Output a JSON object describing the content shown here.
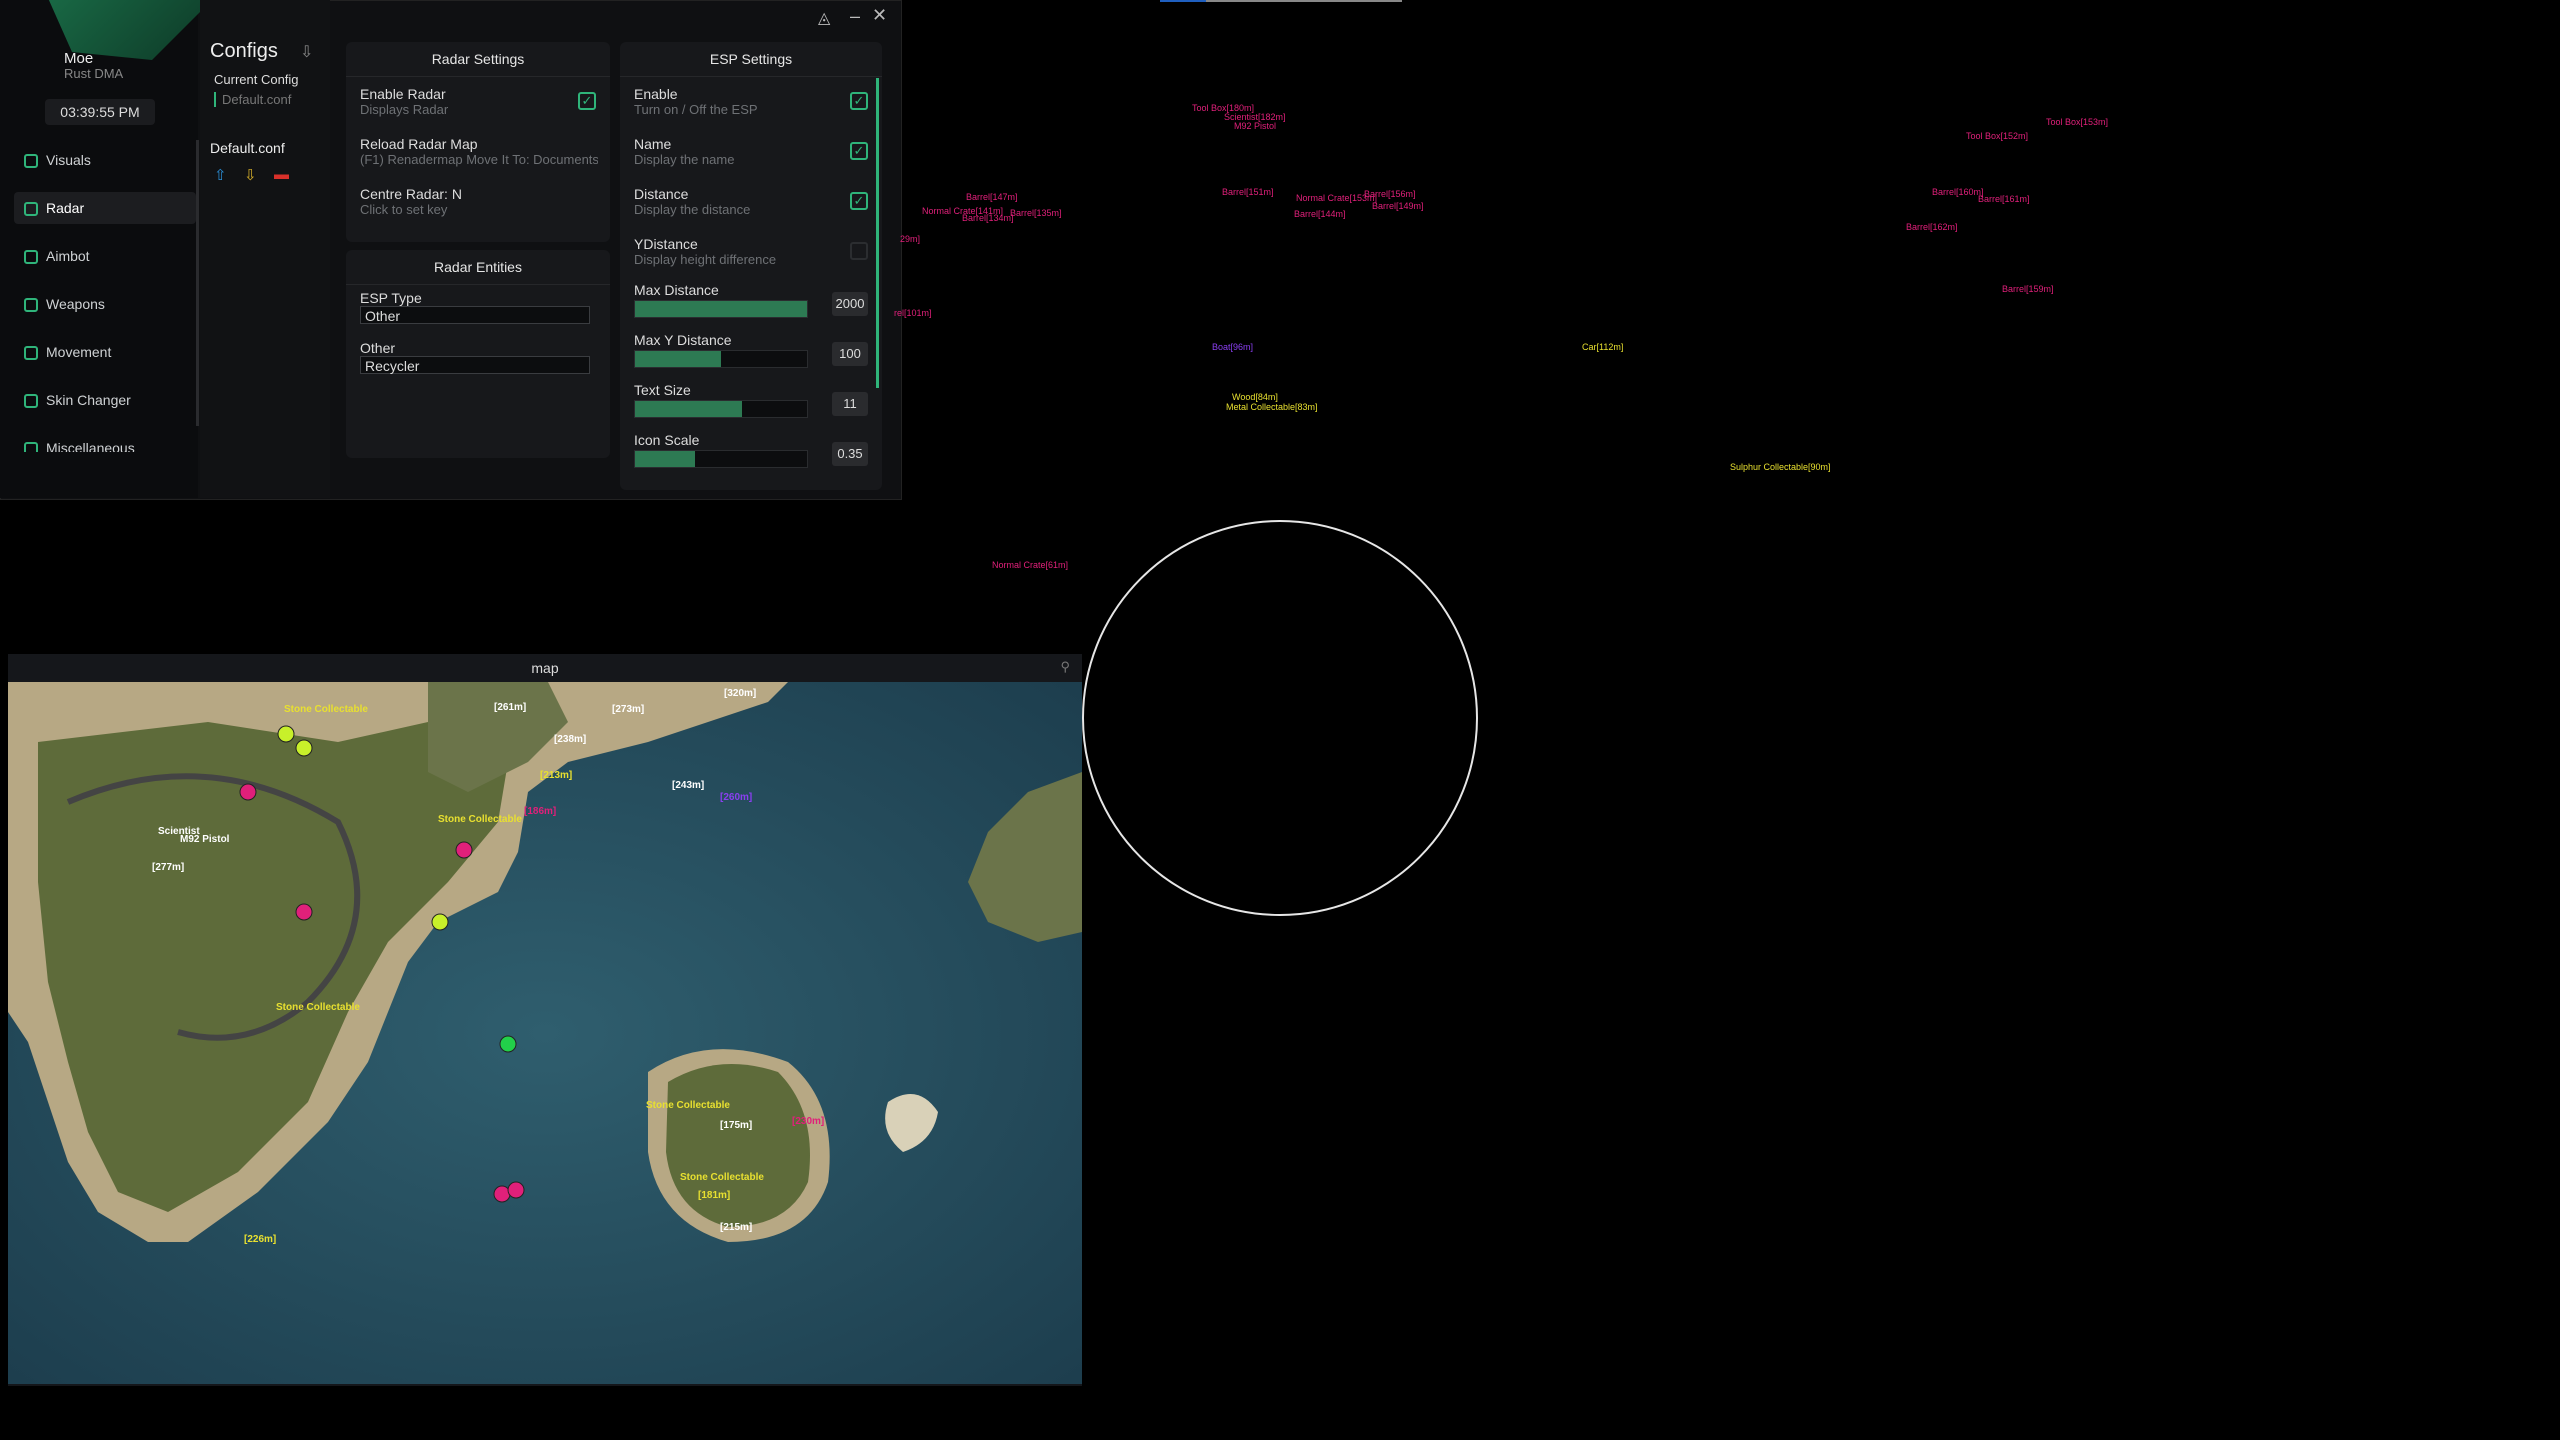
{
  "user": {
    "name": "Moe",
    "product": "Rust DMA",
    "time": "03:39:55 PM"
  },
  "nav": [
    "Visuals",
    "Radar",
    "Aimbot",
    "Weapons",
    "Movement",
    "Skin Changer",
    "Miscellaneous"
  ],
  "nav_active": "Radar",
  "configs": {
    "title": "Configs",
    "current_label": "Current Config",
    "current_value": "Default.conf",
    "items": [
      "Default.conf"
    ]
  },
  "radar_settings": {
    "title": "Radar Settings",
    "rows": [
      {
        "label": "Enable Radar",
        "desc": "Displays Radar",
        "checked": true
      },
      {
        "label": "Reload Radar Map",
        "desc": "(F1) Renadermap Move It To: Documents"
      },
      {
        "label": "Centre Radar: N",
        "desc": "Click to set key"
      }
    ]
  },
  "radar_entities": {
    "title": "Radar Entities",
    "esp_type_label": "ESP Type",
    "esp_type_value": "Other",
    "other_label": "Other",
    "other_value": "Recycler"
  },
  "esp_settings": {
    "title": "ESP Settings",
    "toggles": [
      {
        "label": "Enable",
        "desc": "Turn on / Off the ESP",
        "checked": true
      },
      {
        "label": "Name",
        "desc": "Display the name",
        "checked": true
      },
      {
        "label": "Distance",
        "desc": "Display the distance",
        "checked": true
      },
      {
        "label": "YDistance",
        "desc": "Display height difference",
        "checked": false
      }
    ],
    "sliders": [
      {
        "label": "Max Distance",
        "value": "2000",
        "fill": 1.0
      },
      {
        "label": "Max Y Distance",
        "value": "100",
        "fill": 0.5
      },
      {
        "label": "Text Size",
        "value": "11",
        "fill": 0.62
      },
      {
        "label": "Icon Scale",
        "value": "0.35",
        "fill": 0.35
      }
    ]
  },
  "overlay_labels": [
    {
      "text": "Barrel[147m]",
      "color": "#e0207a"
    },
    {
      "text": "Normal Crate[141m]",
      "color": "#e0207a"
    },
    {
      "text": "Barrel[134m]",
      "color": "#e0207a"
    },
    {
      "text": "Barrel[135m]",
      "color": "#e0207a"
    },
    {
      "text": "Tool Box[180m]",
      "color": "#e0207a"
    },
    {
      "text": "Scientist[182m]",
      "color": "#e0207a"
    },
    {
      "text": "M92 Pistol",
      "color": "#e0207a"
    },
    {
      "text": "Barrel[151m]",
      "color": "#e0207a"
    },
    {
      "text": "Normal Crate[153m]",
      "color": "#e0207a"
    },
    {
      "text": "Barrel[156m]",
      "color": "#e0207a"
    },
    {
      "text": "Barrel[149m]",
      "color": "#e0207a"
    },
    {
      "text": "Barrel[144m]",
      "color": "#e0207a"
    },
    {
      "text": "Tool Box[152m]",
      "color": "#e0207a"
    },
    {
      "text": "Tool Box[153m]",
      "color": "#e0207a"
    },
    {
      "text": "Barrel[160m]",
      "color": "#e0207a"
    },
    {
      "text": "Barrel[161m]",
      "color": "#e0207a"
    },
    {
      "text": "Barrel[162m]",
      "color": "#e0207a"
    },
    {
      "text": "Barrel[159m]",
      "color": "#e0207a"
    },
    {
      "text": "Boat[96m]",
      "color": "#8a3ff0"
    },
    {
      "text": "Car[112m]",
      "color": "#e8e030"
    },
    {
      "text": "Wood[84m]",
      "color": "#e8e030"
    },
    {
      "text": "Metal Collectable[83m]",
      "color": "#e8e030"
    },
    {
      "text": "Sulphur Collectable[90m]",
      "color": "#e8e030"
    },
    {
      "text": "Normal Crate[61m]",
      "color": "#e0207a"
    },
    {
      "text": "rel[101m]",
      "color": "#e0207a"
    },
    {
      "text": "29m]",
      "color": "#e0207a"
    }
  ],
  "map": {
    "title": "map",
    "labels": [
      {
        "text": "Stone Collectable",
        "color": "#e8e030"
      },
      {
        "text": "[261m]",
        "color": "#ffffff"
      },
      {
        "text": "[273m]",
        "color": "#ffffff"
      },
      {
        "text": "[320m]",
        "color": "#ffffff"
      },
      {
        "text": "[238m]",
        "color": "#ffffff"
      },
      {
        "text": "[213m]",
        "color": "#e8e030"
      },
      {
        "text": "[243m]",
        "color": "#ffffff"
      },
      {
        "text": "[186m]",
        "color": "#e0207a"
      },
      {
        "text": "[260m]",
        "color": "#8a3ff0"
      },
      {
        "text": "Stone Collectable",
        "color": "#e8e030"
      },
      {
        "text": "Scientist",
        "color": "#ffffff"
      },
      {
        "text": "M92 Pistol",
        "color": "#ffffff"
      },
      {
        "text": "[277m]",
        "color": "#ffffff"
      },
      {
        "text": "Stone Collectable",
        "color": "#e8e030"
      },
      {
        "text": "Stone Collectable",
        "color": "#e8e030"
      },
      {
        "text": "[175m]",
        "color": "#ffffff"
      },
      {
        "text": "[230m]",
        "color": "#e0207a"
      },
      {
        "text": "Stone Collectable",
        "color": "#e8e030"
      },
      {
        "text": "[181m]",
        "color": "#e8e030"
      },
      {
        "text": "[215m]",
        "color": "#ffffff"
      },
      {
        "text": "[226m]",
        "color": "#e8e030"
      }
    ]
  }
}
